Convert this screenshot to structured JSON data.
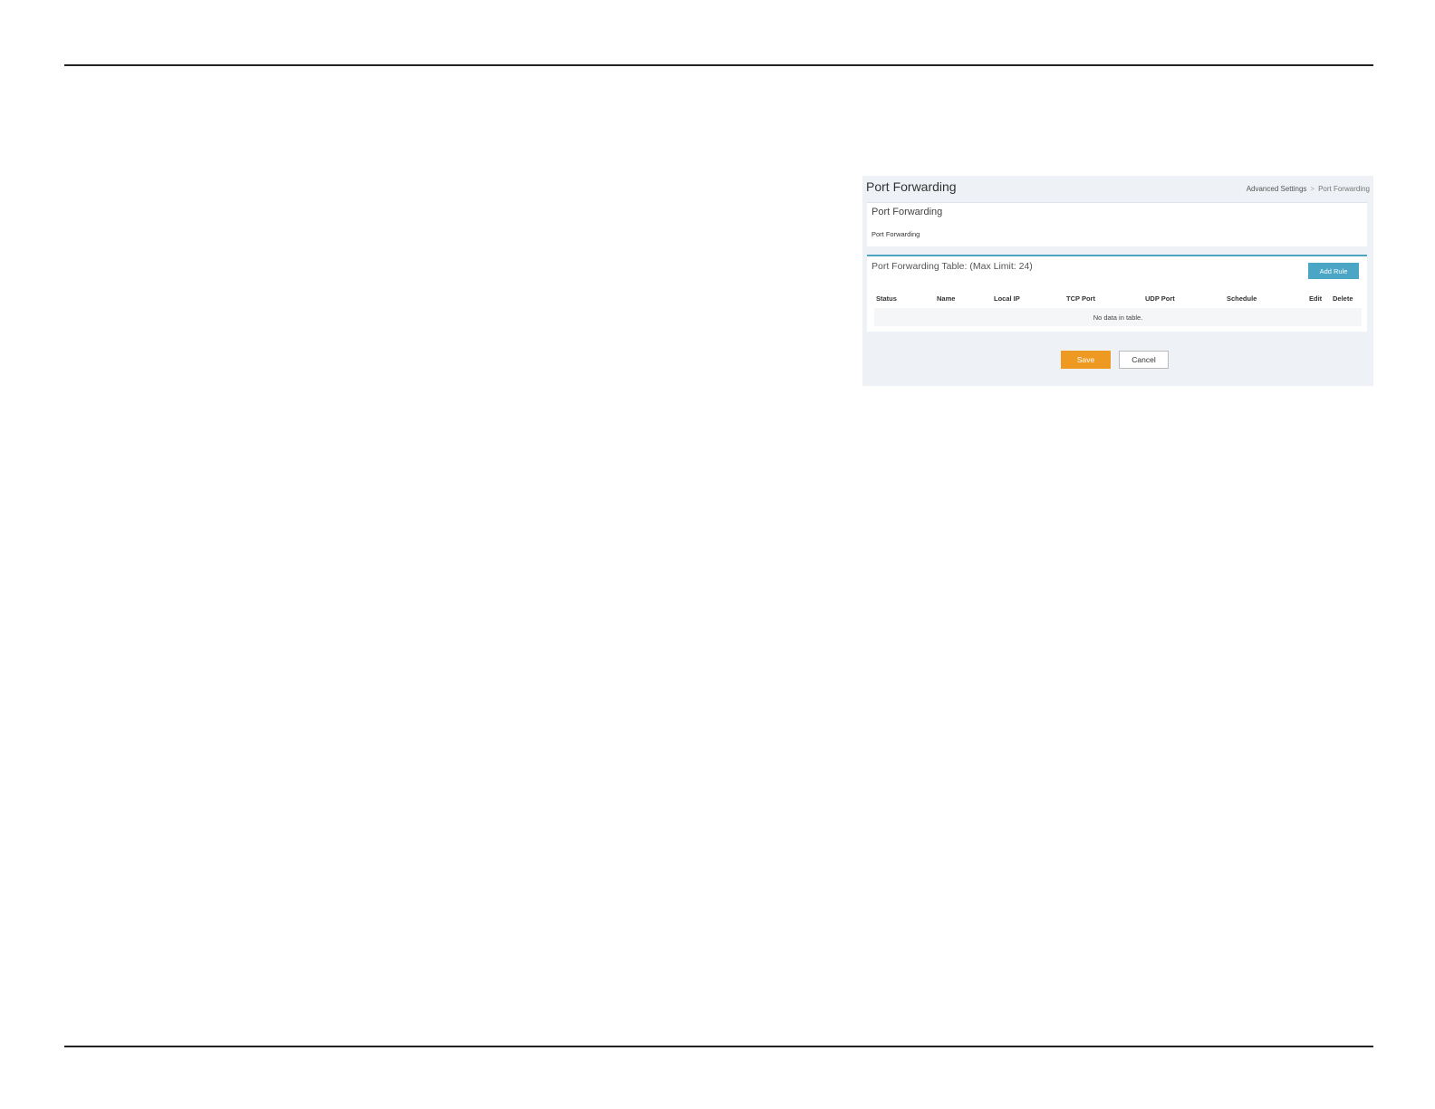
{
  "header": {
    "title": "Port Forwarding",
    "breadcrumb": {
      "parent": "Advanced Settings",
      "separator": ">",
      "current": "Port Forwarding"
    }
  },
  "section_port_forwarding": {
    "header": "Port Forwarding",
    "subtitle": "Port Forwarding"
  },
  "section_table": {
    "title": "Port Forwarding Table: (Max Limit: 24)",
    "add_button_label": "Add Rule",
    "columns": [
      "Status",
      "Name",
      "Local IP",
      "TCP Port",
      "UDP Port",
      "Schedule",
      "Edit",
      "Delete"
    ],
    "empty_message": "No data in table."
  },
  "actions": {
    "save_label": "Save",
    "cancel_label": "Cancel"
  },
  "colors": {
    "accent": "#4aa6c4",
    "save": "#ee9a22",
    "panel_bg": "#eef1f5"
  }
}
